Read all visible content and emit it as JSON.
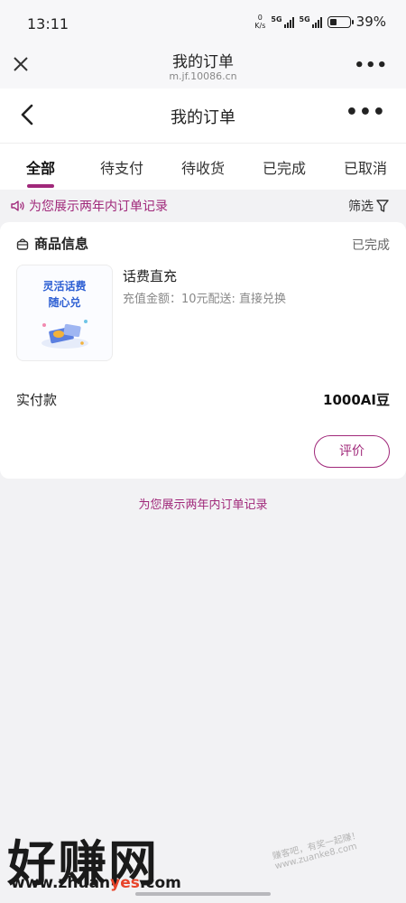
{
  "status_bar": {
    "time": "13:11",
    "net_speed_value": "0",
    "net_speed_unit": "K/s",
    "signal1_label": "5G",
    "signal2_label": "5G",
    "battery_percent": "39%",
    "battery_level": 0.39
  },
  "browser": {
    "title": "我的订单",
    "url": "m.jf.10086.cn",
    "menu_icon": "more-dots-icon",
    "close_icon": "close-icon"
  },
  "header": {
    "title": "我的订单",
    "back_icon": "chevron-left-icon",
    "more_icon": "more-dots-icon"
  },
  "tabs": [
    {
      "label": "全部",
      "active": true
    },
    {
      "label": "待支付",
      "active": false
    },
    {
      "label": "待收货",
      "active": false
    },
    {
      "label": "已完成",
      "active": false
    },
    {
      "label": "已取消",
      "active": false
    }
  ],
  "notice": {
    "text": "为您展示两年内订单记录",
    "filter_label": "筛选",
    "icon": "speaker-icon",
    "filter_icon": "filter-icon"
  },
  "order": {
    "section_title": "商品信息",
    "status": "已完成",
    "thumbnail_line1": "灵活话费",
    "thumbnail_line2": "随心兑",
    "product_name": "话费直充",
    "product_desc": "充值金额：10元配送: 直接兑换",
    "paid_label": "实付款",
    "paid_value": "1000AI豆",
    "rate_button": "评价"
  },
  "footer_note": "为您展示两年内订单记录",
  "watermark": {
    "brand": "好赚网",
    "url_prefix": "www.zhuan",
    "url_highlight": "yes",
    "url_suffix": ".com",
    "tilted_text": "赚客吧，有奖一起赚！www.zuanke8.com"
  },
  "colors": {
    "accent": "#a0287a",
    "background": "#f2f2f4",
    "thumbnail_text": "#2d5fd3"
  }
}
